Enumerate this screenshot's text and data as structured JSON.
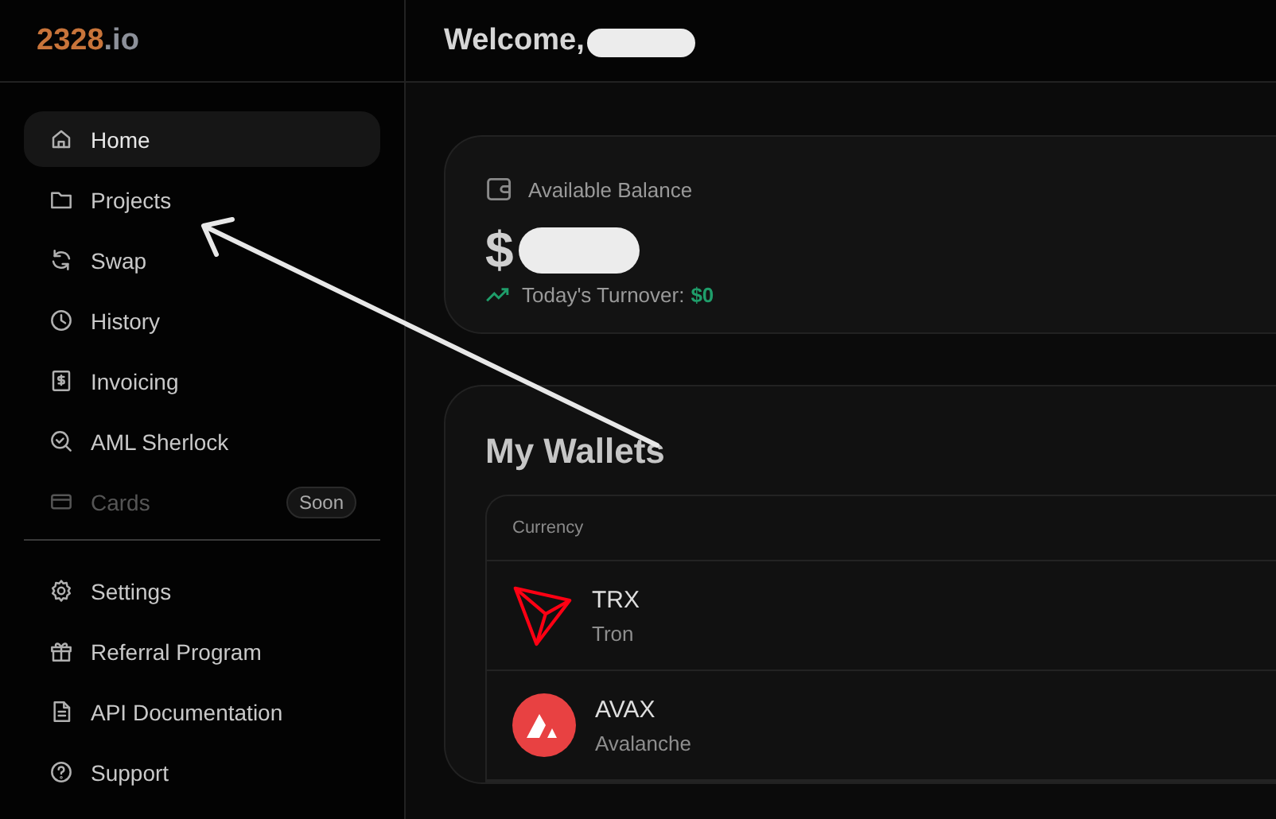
{
  "sidebar": {
    "logo": {
      "main": "2328",
      "suffix": ".io"
    },
    "nav_main": [
      {
        "label": "Home",
        "selected": true,
        "disabled": false
      },
      {
        "label": "Projects",
        "selected": false,
        "disabled": false
      },
      {
        "label": "Swap",
        "selected": false,
        "disabled": false
      },
      {
        "label": "History",
        "selected": false,
        "disabled": false
      },
      {
        "label": "Invoicing",
        "selected": false,
        "disabled": false
      },
      {
        "label": "AML Sherlock",
        "selected": false,
        "disabled": false
      },
      {
        "label": "Cards",
        "selected": false,
        "disabled": true,
        "badge": "Soon"
      }
    ],
    "nav_bottom": [
      {
        "label": "Settings",
        "selected": false,
        "disabled": false
      },
      {
        "label": "Referral Program",
        "selected": false,
        "disabled": false
      },
      {
        "label": "API Documentation",
        "selected": false,
        "disabled": false
      },
      {
        "label": "Support",
        "selected": false,
        "disabled": false
      }
    ]
  },
  "header": {
    "title": "Welcome,"
  },
  "balance_card": {
    "label": "Available Balance",
    "currency": "$",
    "turnover_label": "Today's Turnover:",
    "turnover_value": "$0"
  },
  "wallets": {
    "title": "My Wallets",
    "columns": [
      "Currency"
    ],
    "rows": [
      {
        "symbol": "TRX",
        "name": "Tron"
      },
      {
        "symbol": "AVAX",
        "name": "Avalanche"
      }
    ]
  }
}
